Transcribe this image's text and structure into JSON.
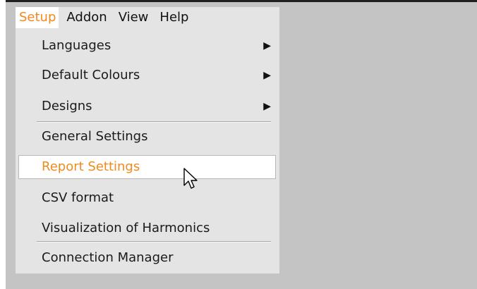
{
  "menubar": {
    "items": [
      {
        "label": "Setup",
        "active": true
      },
      {
        "label": "Addon",
        "active": false
      },
      {
        "label": "View",
        "active": false
      },
      {
        "label": "Help",
        "active": false
      }
    ]
  },
  "setup_menu": {
    "items": [
      {
        "label": "Languages",
        "submenu": true
      },
      {
        "label": "Default Colours",
        "submenu": true
      },
      {
        "label": "Designs",
        "submenu": true
      },
      {
        "label": "General Settings",
        "submenu": false
      },
      {
        "label": "Report Settings",
        "submenu": false,
        "highlighted": true
      },
      {
        "label": "CSV format",
        "submenu": false
      },
      {
        "label": "Visualization of Harmonics",
        "submenu": false
      },
      {
        "label": "Connection Manager",
        "submenu": false
      }
    ],
    "submenu_arrow_icon": "triangle-right-icon"
  },
  "colors": {
    "accent": "#f08a1c",
    "menu_background": "#e4e4e4",
    "app_background": "#c4c4c4",
    "highlight_background": "#ffffff"
  },
  "cursor_icon": "arrow-pointer-icon"
}
